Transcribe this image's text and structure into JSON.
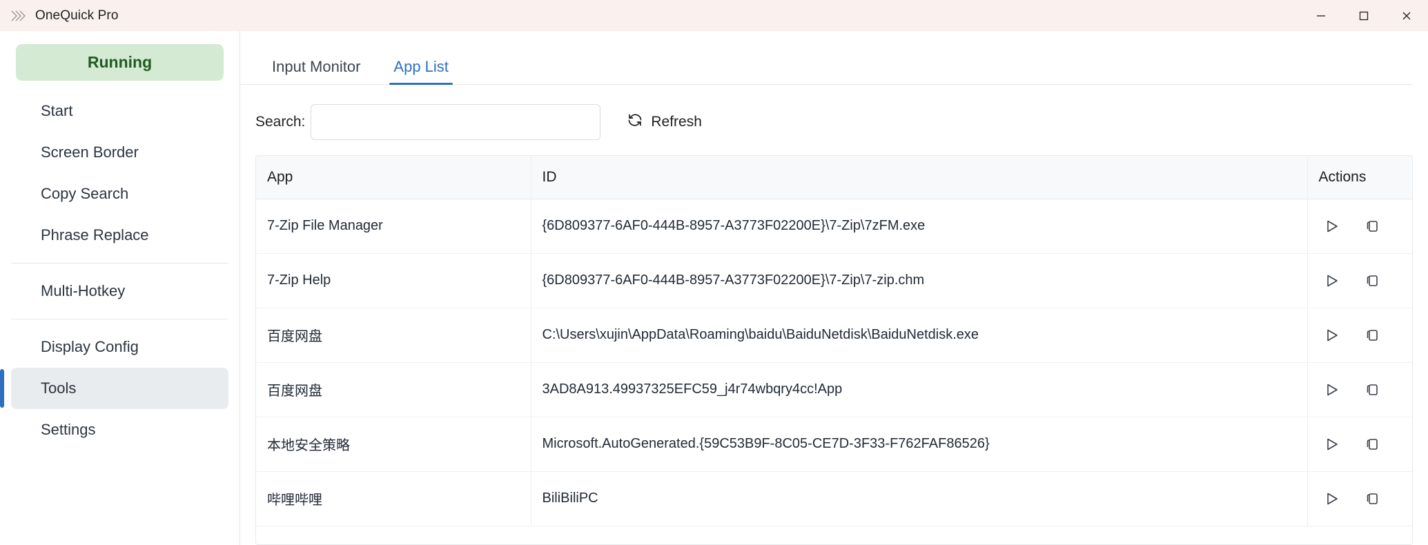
{
  "window": {
    "title": "OneQuick Pro",
    "logo_icon": "double-chevron-icon",
    "titlebar_color": "#faf0ed",
    "controls": {
      "minimize": "minimize-icon",
      "maximize": "maximize-icon",
      "close": "close-icon"
    }
  },
  "sidebar": {
    "status": {
      "label": "Running",
      "bg_color": "#d4ead3",
      "text_color": "#1f5c22"
    },
    "accent_color": "#2f6fc0",
    "items": [
      {
        "label": "Start",
        "selected": false
      },
      {
        "label": "Screen Border",
        "selected": false
      },
      {
        "label": "Copy Search",
        "selected": false
      },
      {
        "label": "Phrase Replace",
        "selected": false
      },
      {
        "label": "Multi-Hotkey",
        "selected": false
      },
      {
        "label": "Display Config",
        "selected": false
      },
      {
        "label": "Tools",
        "selected": true
      },
      {
        "label": "Settings",
        "selected": false
      }
    ]
  },
  "tabs": [
    {
      "label": "Input Monitor",
      "active": false
    },
    {
      "label": "App List",
      "active": true
    }
  ],
  "toolbar": {
    "search_label": "Search:",
    "search_value": "",
    "search_placeholder": "",
    "refresh_label": "Refresh",
    "refresh_icon": "refresh-icon"
  },
  "table": {
    "columns": [
      "App",
      "ID",
      "Actions"
    ],
    "row_actions": [
      {
        "name": "launch-button",
        "icon": "play-icon"
      },
      {
        "name": "copy-button",
        "icon": "copy-icon"
      }
    ],
    "rows": [
      {
        "app": "7-Zip File Manager",
        "id": "{6D809377-6AF0-444B-8957-A3773F02200E}\\7-Zip\\7zFM.exe"
      },
      {
        "app": "7-Zip Help",
        "id": "{6D809377-6AF0-444B-8957-A3773F02200E}\\7-Zip\\7-zip.chm"
      },
      {
        "app": "百度网盘",
        "id": "C:\\Users\\xujin\\AppData\\Roaming\\baidu\\BaiduNetdisk\\BaiduNetdisk.exe"
      },
      {
        "app": "百度网盘",
        "id": "3AD8A913.49937325EFC59_j4r74wbqry4cc!App"
      },
      {
        "app": "本地安全策略",
        "id": "Microsoft.AutoGenerated.{59C53B9F-8C05-CE7D-3F33-F762FAF86526}"
      },
      {
        "app": "哔哩哔哩",
        "id": "BiliBiliPC"
      }
    ]
  }
}
